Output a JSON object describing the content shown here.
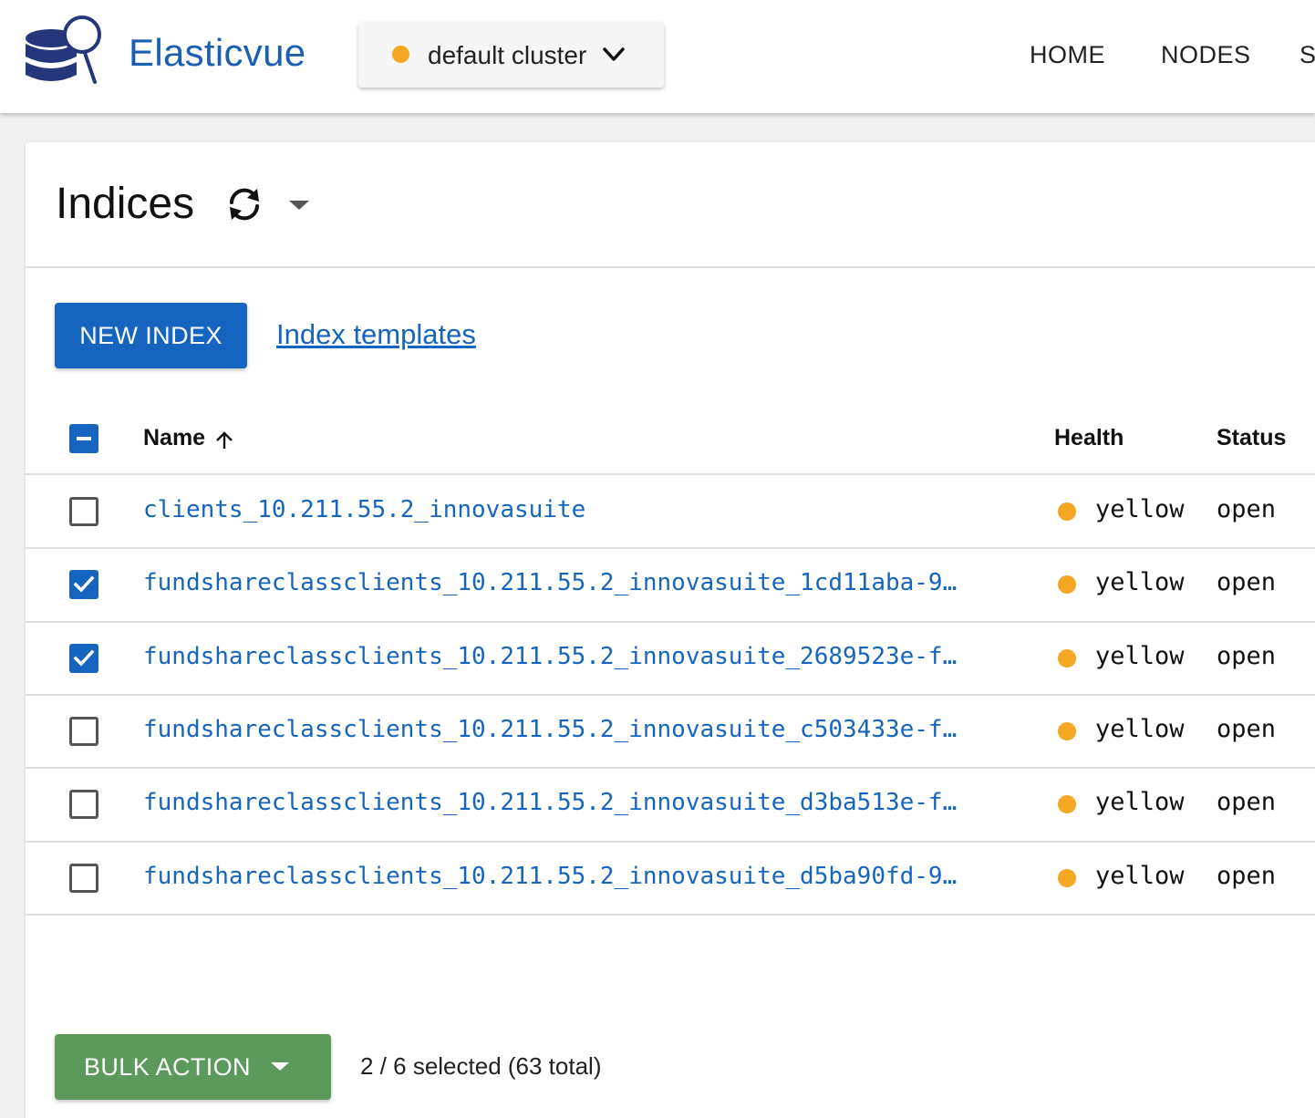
{
  "colors": {
    "brand": "#1a5fb4",
    "primary": "#1565c0",
    "link": "#1565c0",
    "success": "#5b9a5b",
    "warning": "#f5a623"
  },
  "header": {
    "brand": "Elasticvue",
    "logo_icon": "database-search-icon",
    "cluster": {
      "name": "default cluster",
      "health_color": "#f5a623",
      "icon": "chevron-down-icon"
    },
    "nav": [
      "HOME",
      "NODES",
      "S"
    ]
  },
  "page": {
    "title": "Indices",
    "refresh_icon": "refresh-icon",
    "refresh_menu_icon": "caret-down-icon",
    "new_index_label": "NEW INDEX",
    "templates_link": "Index templates"
  },
  "table": {
    "columns": {
      "name": "Name",
      "health": "Health",
      "status": "Status"
    },
    "sort_icon": "arrow-up-icon",
    "select_all_state": "indeterminate",
    "rows": [
      {
        "name": "clients_10.211.55.2_innovasuite",
        "health": "yellow",
        "status": "open",
        "selected": false
      },
      {
        "name": "fundshareclassclients_10.211.55.2_innovasuite_1cd11aba-9…",
        "health": "yellow",
        "status": "open",
        "selected": true
      },
      {
        "name": "fundshareclassclients_10.211.55.2_innovasuite_2689523e-f…",
        "health": "yellow",
        "status": "open",
        "selected": true
      },
      {
        "name": "fundshareclassclients_10.211.55.2_innovasuite_c503433e-f…",
        "health": "yellow",
        "status": "open",
        "selected": false
      },
      {
        "name": "fundshareclassclients_10.211.55.2_innovasuite_d3ba513e-f…",
        "health": "yellow",
        "status": "open",
        "selected": false
      },
      {
        "name": "fundshareclassclients_10.211.55.2_innovasuite_d5ba90fd-9…",
        "health": "yellow",
        "status": "open",
        "selected": false
      }
    ]
  },
  "footer": {
    "bulk_action_label": "BULK ACTION",
    "bulk_action_icon": "caret-down-icon",
    "selection_text": "2 / 6 selected (63 total)"
  }
}
